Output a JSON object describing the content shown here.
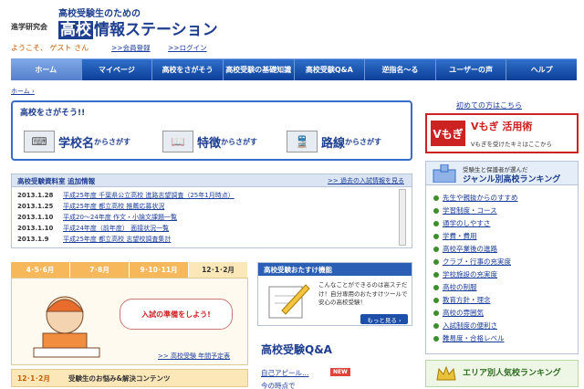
{
  "header": {
    "logo_small": "進学研究会",
    "logo_tagline": "高校受験生のための",
    "logo_kk": "高校",
    "logo_main": "情報ステーション",
    "welcome": "ようこそ、 ゲスト さん",
    "register_link": ">>会員登録",
    "login_link": ">>ログイン"
  },
  "nav": [
    "ホーム",
    "マイページ",
    "高校をさがそう",
    "高校受験の基礎知識",
    "高校受験Q&A",
    "逆指名～る",
    "ユーザーの声",
    "ヘルプ"
  ],
  "breadcrumb": "ホーム ›",
  "search": {
    "title": "高校をさがそう!!",
    "buttons": [
      {
        "big": "学校名",
        "small": "からさがす",
        "icon": "keyboard-icon"
      },
      {
        "big": "特徴",
        "small": "からさがす",
        "icon": "book-icon"
      },
      {
        "big": "路線",
        "small": "からさがす",
        "icon": "train-icon"
      }
    ]
  },
  "news": {
    "title": "高校受験資料室 追加情報",
    "past_link": ">> 過去の入試情報を見る",
    "items": [
      {
        "date": "2013.1.28",
        "text": "平成25年度 千葉県公立高校 進路志望調査（25年1月時点）"
      },
      {
        "date": "2013.1.25",
        "text": "平成25年度 都立高校 推薦応募状況"
      },
      {
        "date": "2013.1.10",
        "text": "平成20～24年度 作文・小論文課題一覧"
      },
      {
        "date": "2013.1.10",
        "text": "平成24年度（前年度） 面接状況一覧"
      },
      {
        "date": "2013.1.9",
        "text": "平成25年度 都立高校 志望校調査集計"
      }
    ]
  },
  "seasons": {
    "tabs": [
      "4･5･6月",
      "7･8月",
      "9･10･11月",
      "12･1･2月"
    ],
    "bubble": "入試の準備をしよう!",
    "schedule_link": ">> 高校受験 年間予定表",
    "worries_tag": "12･1･2月",
    "worries_title": "受験生のお悩み&解決コンテンツ"
  },
  "recommend": {
    "title": "高校受験おたすけ機能",
    "text": "こんなことができるのは高ステだけ！自分専用のおたすけツールで安心の高校受験！",
    "more": "もっと見る ›"
  },
  "qa": {
    "title": "高校受験Q&A",
    "items": [
      "自己アピール…",
      "今の時点で"
    ],
    "new_badge": "NEW"
  },
  "sidebar": {
    "first_visit": "初めての方はこちら",
    "vmogi_v": "Vもぎ",
    "vmogi_title": "Vもぎ 活用術",
    "vmogi_sub": "Vもぎを受けたキミはここから",
    "ranking_sub": "受験生と保護者が選んだ",
    "ranking_title": "ジャンル別高校ランキング",
    "ranking_items": [
      "先生や親抜からのすすめ",
      "学習制度・コース",
      "通学のしやすさ",
      "学費・費用",
      "高校卒業後の進路",
      "クラブ・行事の充実度",
      "学校施設の充実度",
      "高校の制服",
      "教育方針・理念",
      "高校の雰囲気",
      "入試制度の便利さ",
      "難易度・合格レベル"
    ],
    "area_ranking": "エリア別人気校ランキング"
  }
}
